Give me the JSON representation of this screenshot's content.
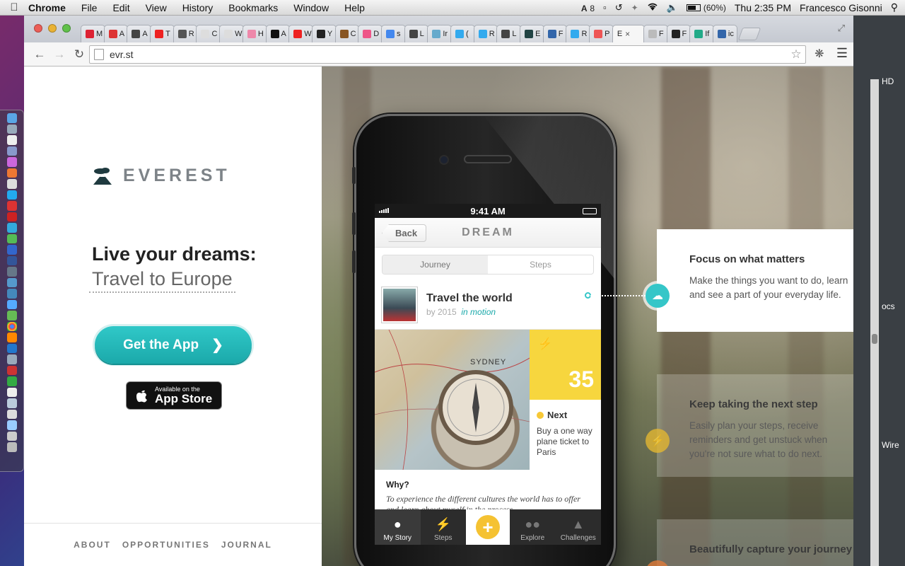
{
  "menubar": {
    "app_name": "Chrome",
    "menus": [
      "File",
      "Edit",
      "View",
      "History",
      "Bookmarks",
      "Window",
      "Help"
    ],
    "adobe_count": "8",
    "battery": "(60%)",
    "clock": "Thu 2:35 PM",
    "user": "Francesco Gisonni"
  },
  "browser": {
    "tabs": [
      {
        "label": "M",
        "color": "#d23"
      },
      {
        "label": "A",
        "color": "#d33"
      },
      {
        "label": "A",
        "color": "#444"
      },
      {
        "label": "T",
        "color": "#e22"
      },
      {
        "label": "R",
        "color": "#555"
      },
      {
        "label": "C",
        "color": "#ddd"
      },
      {
        "label": "W",
        "color": "#ddd"
      },
      {
        "label": "H",
        "color": "#e8a"
      },
      {
        "label": "A",
        "color": "#111"
      },
      {
        "label": "W",
        "color": "#e22"
      },
      {
        "label": "Y",
        "color": "#222"
      },
      {
        "label": "C",
        "color": "#852"
      },
      {
        "label": "D",
        "color": "#e58"
      },
      {
        "label": "s",
        "color": "#48e"
      },
      {
        "label": "L",
        "color": "#444"
      },
      {
        "label": "Ir",
        "color": "#6ac"
      },
      {
        "label": "(",
        "color": "#3ae"
      },
      {
        "label": "R",
        "color": "#3ae"
      },
      {
        "label": "L",
        "color": "#444"
      },
      {
        "label": "E",
        "color": "#244"
      },
      {
        "label": "F",
        "color": "#36a"
      },
      {
        "label": "R",
        "color": "#3ae"
      },
      {
        "label": "P",
        "color": "#e55"
      }
    ],
    "active_tab_label": "E",
    "active_tab_close": "×",
    "tabs_after": [
      {
        "label": "F",
        "color": "#bbb"
      },
      {
        "label": "F",
        "color": "#222"
      },
      {
        "label": "If",
        "color": "#2a8"
      },
      {
        "label": "ic",
        "color": "#36a"
      }
    ],
    "url": "evr.st"
  },
  "site": {
    "brand": "EVEREST",
    "headline": "Live your dreams:",
    "subline": "Travel to Europe",
    "cta": "Get the App",
    "appstore_small": "Available on the",
    "appstore_big": "App Store",
    "footer": [
      "ABOUT",
      "OPPORTUNITIES",
      "JOURNAL"
    ]
  },
  "phone": {
    "time": "9:41 AM",
    "back": "Back",
    "screen_title": "DREAM",
    "segments": [
      "Journey",
      "Steps"
    ],
    "story_title": "Travel the world",
    "story_by": "by 2015",
    "story_status": "in motion",
    "map_label": "SYDNEY",
    "count": "35",
    "next_label": "Next",
    "next_text": "Buy a one way plane ticket to Paris",
    "why_label": "Why?",
    "why_text": "To experience the different cultures the world has to offer and learn about myself in the process",
    "tabbar": [
      "My Story",
      "Steps",
      "Explore",
      "Challenges"
    ],
    "plus": "+"
  },
  "features": [
    {
      "title": "Focus on what matters",
      "body": "Make the things you want to do, learn and see a part of your everyday life.",
      "icon": "cloud-icon",
      "color": "#35c6c8"
    },
    {
      "title": "Keep taking the next step",
      "body": "Easily plan your steps, receive reminders and get unstuck when you're not sure what to do next.",
      "icon": "bolt-icon",
      "color": "#e2b632"
    },
    {
      "title": "Beautifully capture your journey",
      "body": "",
      "icon": "camera-icon",
      "color": "#e07a3a"
    }
  ],
  "peek": {
    "label1": "HD",
    "label2": "ocs",
    "label3": "Wire"
  }
}
